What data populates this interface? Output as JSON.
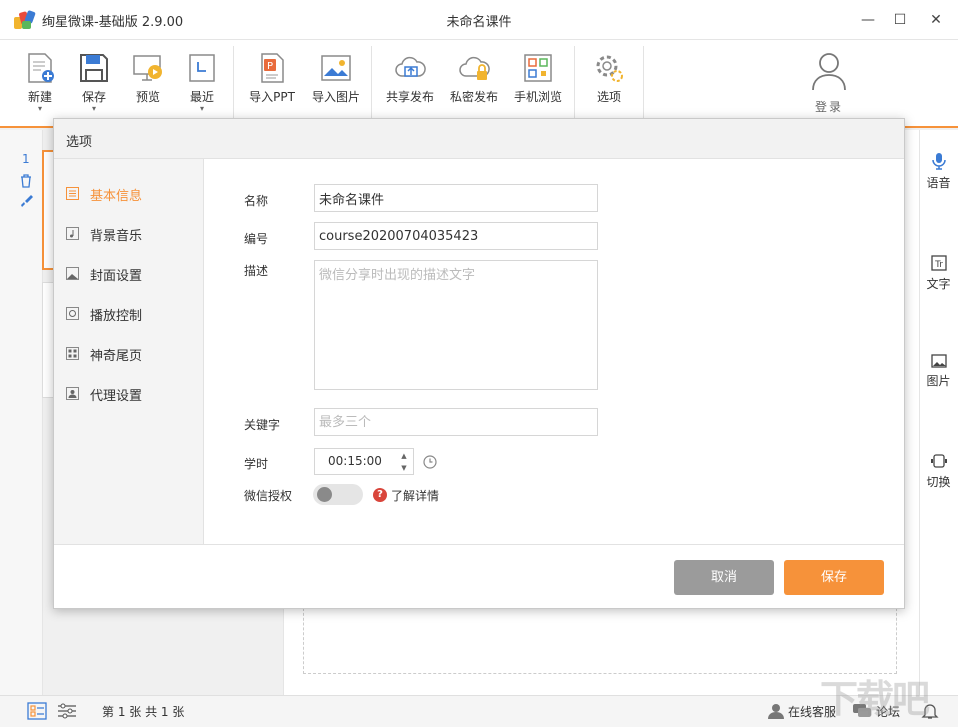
{
  "window": {
    "app_title": "绚星微课-基础版 2.9.00",
    "doc_title": "未命名课件",
    "minimize_glyph": "—",
    "maximize_glyph": "☐",
    "close_glyph": "✕"
  },
  "toolbar": {
    "new_label": "新建",
    "save_label": "保存",
    "preview_label": "预览",
    "recent_label": "最近",
    "import_ppt_label": "导入PPT",
    "import_image_label": "导入图片",
    "share_publish_label": "共享发布",
    "private_publish_label": "私密发布",
    "mobile_browse_label": "手机浏览",
    "options_label": "选项",
    "login_label": "登录",
    "caret": "▾"
  },
  "workspace": {
    "slide_number": "1"
  },
  "right_panel": {
    "voice_label": "语音",
    "text_label": "文字",
    "image_label": "图片",
    "switch_label": "切换"
  },
  "statusbar": {
    "page_info": "第 1 张  共 1 张",
    "online_service": "在线客服",
    "forum": "论坛"
  },
  "dialog": {
    "title": "选项",
    "nav": [
      {
        "label": "基本信息",
        "active": true
      },
      {
        "label": "背景音乐"
      },
      {
        "label": "封面设置"
      },
      {
        "label": "播放控制"
      },
      {
        "label": "神奇尾页"
      },
      {
        "label": "代理设置"
      }
    ],
    "form": {
      "name_label": "名称",
      "name_value": "未命名课件",
      "id_label": "编号",
      "id_value": "course20200704035423",
      "desc_label": "描述",
      "desc_placeholder": "微信分享时出现的描述文字",
      "keywords_label": "关键字",
      "keywords_placeholder": "最多三个",
      "duration_label": "学时",
      "duration_value": "00:15:00",
      "wechat_label": "微信授权",
      "wechat_enabled": false,
      "help_glyph": "?",
      "help_link": "了解详情"
    },
    "cancel_label": "取消",
    "save_label": "保存"
  },
  "colors": {
    "accent": "#f6923a",
    "cancel_button": "#9b9b9b",
    "help_red": "#d9453b",
    "slide_number_blue": "#3b7bd4"
  },
  "watermark": "下载吧"
}
